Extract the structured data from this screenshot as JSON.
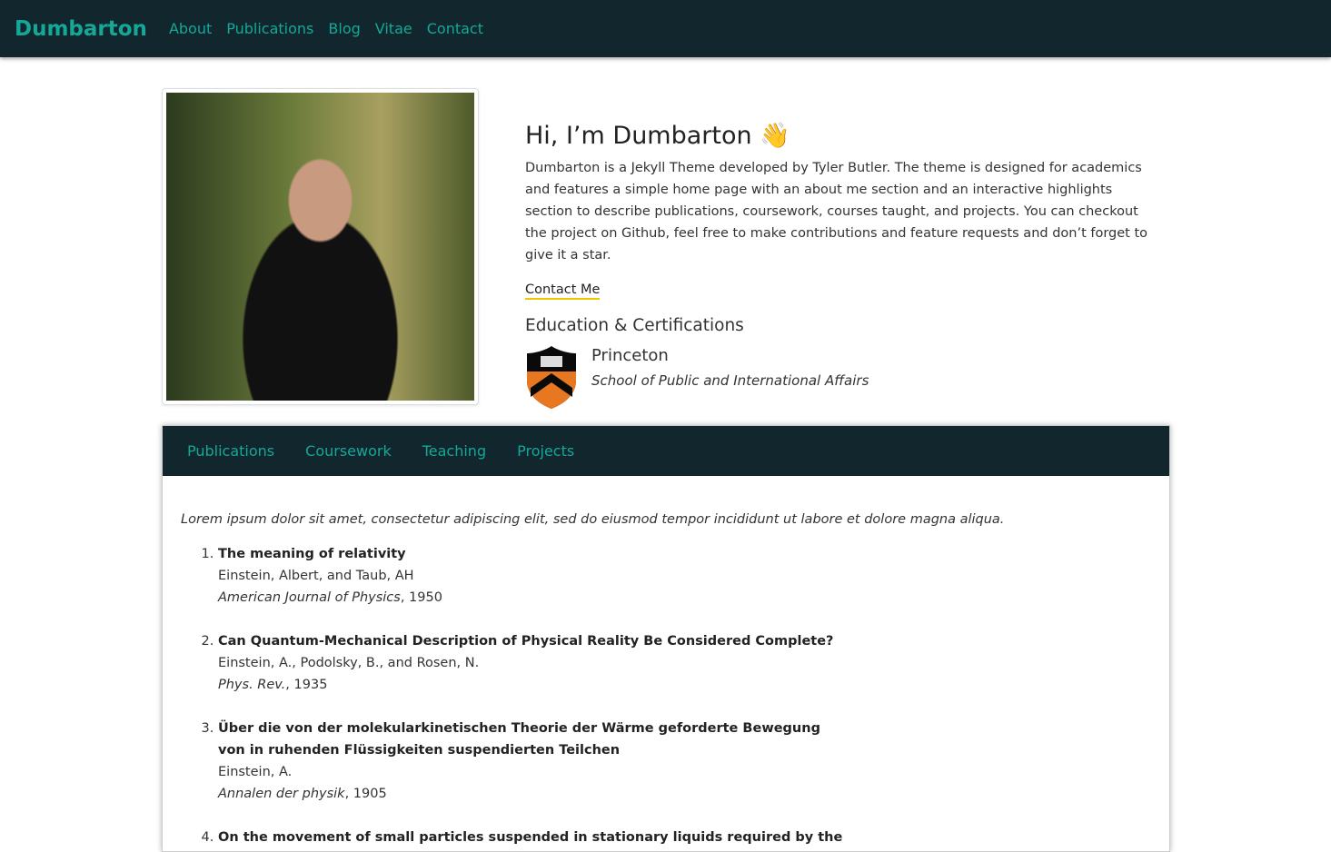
{
  "nav": {
    "brand": "Dumbarton",
    "links": [
      "About",
      "Publications",
      "Blog",
      "Vitae",
      "Contact"
    ]
  },
  "about": {
    "title": "Hi, I’m Dumbarton",
    "emoji": "👋",
    "bio": "Dumbarton is a Jekyll Theme developed by Tyler Butler. The theme is designed for academics and features a simple home page with an about me section and an interactive highlights section to describe publications, coursework, courses taught, and projects. You can checkout the project on Github, feel free to make contributions and feature requests and don’t forget to give it a star.",
    "contact": "Contact Me",
    "education_heading": "Education & Certifications",
    "school": "Princeton",
    "dept": "School of Public and International Affairs"
  },
  "colors": {
    "nav_bg": "#12262e",
    "accent": "#14a898",
    "underline": "#f5c400"
  },
  "tabs": [
    "Publications",
    "Coursework",
    "Teaching",
    "Projects"
  ],
  "intro": "Lorem ipsum dolor sit amet, consectetur adipiscing elit, sed do eiusmod tempor incididunt ut labore et dolore magna aliqua.",
  "pubs": [
    {
      "title": "The meaning of relativity",
      "authors": "Einstein, Albert, and Taub, AH",
      "journal": "American Journal of Physics",
      "year": ", 1950"
    },
    {
      "title": "Can Quantum-Mechanical Description of Physical Reality Be Considered Complete?",
      "authors": "Einstein, A., Podolsky, B., and Rosen, N.",
      "journal": "Phys. Rev.",
      "year": ", 1935"
    },
    {
      "title": "Über die von der molekularkinetischen Theorie der Wärme geforderte Bewegung von in ruhenden Flüssigkeiten suspendierten Teilchen",
      "authors": "Einstein, A.",
      "journal": "Annalen der physik",
      "year": ", 1905"
    },
    {
      "title": "On the movement of small particles suspended in stationary liquids required by the",
      "authors": "",
      "journal": "",
      "year": ""
    }
  ]
}
